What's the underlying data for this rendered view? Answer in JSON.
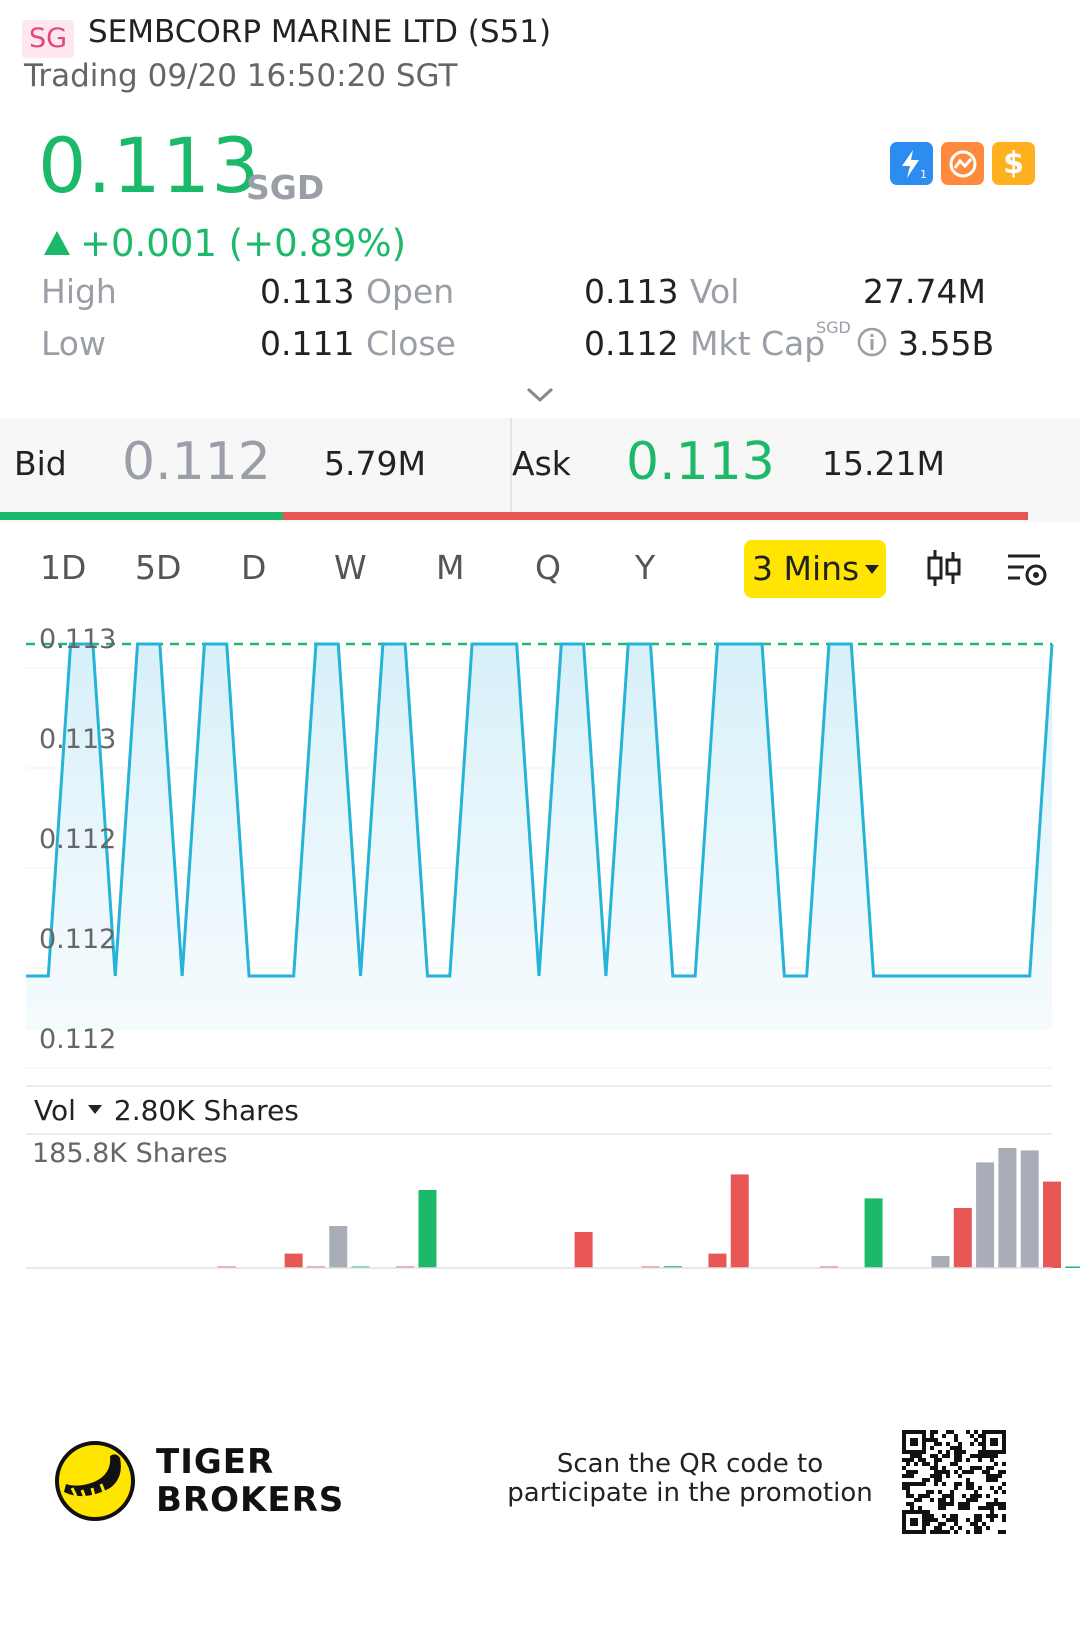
{
  "header": {
    "market_badge": "SG",
    "title": "SEMBCORP MARINE LTD (S51)",
    "status": "Trading 09/20 16:50:20 SGT"
  },
  "quote": {
    "price": "0.113",
    "currency": "SGD",
    "change": "+0.001 (+0.89%)",
    "up_color": "#1db96a",
    "down_color": "#e85656"
  },
  "quote_icons": [
    "lightning-1-icon",
    "options-chain-icon",
    "dollar-icon"
  ],
  "stats": {
    "high_label": "High",
    "high": "0.113",
    "low_label": "Low",
    "low": "0.111",
    "open_label": "Open",
    "open": "0.113",
    "close_label": "Close",
    "close": "0.112",
    "vol_label": "Vol",
    "vol": "27.74M",
    "mktcap_label": "Mkt Cap",
    "mktcap_unit": "SGD",
    "mktcap": "3.55B"
  },
  "orderbook": {
    "bid_label": "Bid",
    "bid_price": "0.112",
    "bid_size": "5.79M",
    "ask_label": "Ask",
    "ask_price": "0.113",
    "ask_size": "15.21M",
    "bid_ratio": 0.275
  },
  "tabs": [
    "1D",
    "5D",
    "D",
    "W",
    "M",
    "Q",
    "Y"
  ],
  "active_tab": "3 Mins",
  "volume": {
    "label": "Vol",
    "value": "2.80K Shares",
    "max_label": "185.8K Shares"
  },
  "footer": {
    "brand_line1": "TIGER",
    "brand_line2": "BROKERS",
    "promo_text": "Scan the QR code to participate in the promotion",
    "brand_color": "#ffe500"
  },
  "chart_data": {
    "type": "area",
    "y_tick_labels": [
      "0.113",
      "0.113",
      "0.112",
      "0.112",
      "0.112"
    ],
    "ref_line": 0.113,
    "values": [
      0.111,
      0.111,
      0.113,
      0.113,
      0.111,
      0.113,
      0.113,
      0.111,
      0.113,
      0.113,
      0.111,
      0.111,
      0.111,
      0.113,
      0.113,
      0.111,
      0.113,
      0.113,
      0.111,
      0.111,
      0.113,
      0.113,
      0.113,
      0.111,
      0.113,
      0.113,
      0.111,
      0.113,
      0.113,
      0.111,
      0.111,
      0.113,
      0.113,
      0.113,
      0.111,
      0.111,
      0.113,
      0.113,
      0.111,
      0.111,
      0.111,
      0.111,
      0.111,
      0.111,
      0.111,
      0.111,
      0.113
    ],
    "line_color": "#25b3d7",
    "volume_bars": [
      {
        "index": 9,
        "value": 0.005,
        "color": "red"
      },
      {
        "index": 12,
        "value": 0.12,
        "color": "red"
      },
      {
        "index": 13,
        "value": 0.01,
        "color": "red"
      },
      {
        "index": 14,
        "value": 0.35,
        "color": "gray"
      },
      {
        "index": 15,
        "value": 0.01,
        "color": "green"
      },
      {
        "index": 17,
        "value": 0.01,
        "color": "red"
      },
      {
        "index": 18,
        "value": 0.65,
        "color": "green"
      },
      {
        "index": 25,
        "value": 0.3,
        "color": "red"
      },
      {
        "index": 28,
        "value": 0.008,
        "color": "red"
      },
      {
        "index": 29,
        "value": 0.015,
        "color": "green"
      },
      {
        "index": 31,
        "value": 0.12,
        "color": "red"
      },
      {
        "index": 32,
        "value": 0.78,
        "color": "red"
      },
      {
        "index": 36,
        "value": 0.008,
        "color": "red"
      },
      {
        "index": 38,
        "value": 0.58,
        "color": "green"
      },
      {
        "index": 41,
        "value": 0.1,
        "color": "gray"
      },
      {
        "index": 42,
        "value": 0.5,
        "color": "red"
      },
      {
        "index": 43,
        "value": 0.88,
        "color": "gray"
      },
      {
        "index": 44,
        "value": 1.0,
        "color": "gray"
      },
      {
        "index": 45,
        "value": 0.98,
        "color": "gray"
      },
      {
        "index": 46,
        "value": 0.72,
        "color": "red"
      },
      {
        "index": 47,
        "value": 0.01,
        "color": "green"
      }
    ]
  }
}
